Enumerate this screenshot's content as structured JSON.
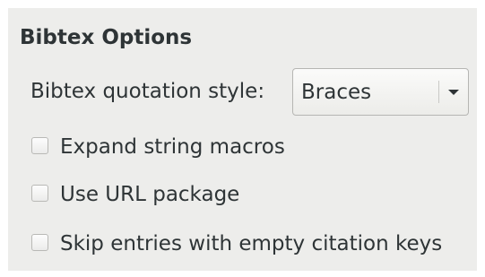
{
  "section": {
    "title": "Bibtex Options"
  },
  "quotation": {
    "label": "Bibtex quotation style:",
    "selected": "Braces"
  },
  "options": [
    {
      "label": "Expand string macros",
      "checked": false
    },
    {
      "label": "Use URL package",
      "checked": false
    },
    {
      "label": "Skip entries with empty citation keys",
      "checked": false
    }
  ]
}
